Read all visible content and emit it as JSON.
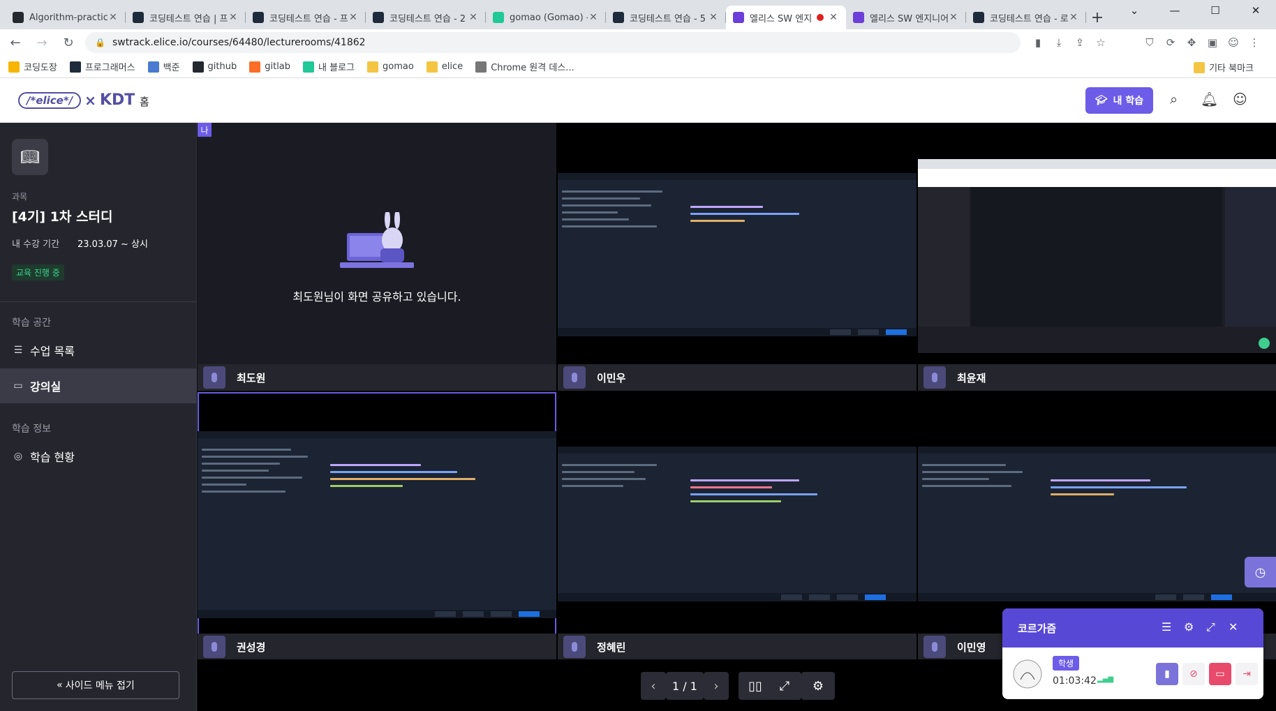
{
  "browser": {
    "tabs": [
      {
        "title": "Algorithm-practice/",
        "icon": "github-icon",
        "color": "#24292f"
      },
      {
        "title": "코딩테스트 연습 | 프",
        "icon": "programmers-icon",
        "color": "#1e2b3c"
      },
      {
        "title": "코딩테스트 연습 - 프",
        "icon": "programmers-icon",
        "color": "#1e2b3c"
      },
      {
        "title": "코딩테스트 연습 - 2",
        "icon": "programmers-icon",
        "color": "#1e2b3c"
      },
      {
        "title": "gomao (Gomao) - v",
        "icon": "velog-icon",
        "color": "#20c997"
      },
      {
        "title": "코딩테스트 연습 - 5",
        "icon": "programmers-icon",
        "color": "#1e2b3c"
      },
      {
        "title": "엘리스 SW 엔지",
        "icon": "elice-icon",
        "color": "#6c3fd9",
        "active": true
      },
      {
        "title": "엘리스 SW 엔지니어",
        "icon": "elice-icon",
        "color": "#6c3fd9"
      },
      {
        "title": "코딩테스트 연습 - 로",
        "icon": "programmers-icon",
        "color": "#1e2b3c"
      }
    ],
    "url": "swtrack.elice.io/courses/64480/lecturerooms/41862",
    "bookmarks": [
      {
        "label": "코딩도장",
        "color": "#f7b500"
      },
      {
        "label": "프로그래머스",
        "color": "#1e2b3c"
      },
      {
        "label": "백준",
        "color": "#4a7bd0"
      },
      {
        "label": "github",
        "color": "#24292f"
      },
      {
        "label": "gitlab",
        "color": "#fc6d26"
      },
      {
        "label": "내 블로그",
        "color": "#20c997"
      },
      {
        "label": "gomao",
        "color": "#f4c542"
      },
      {
        "label": "elice",
        "color": "#f4c542"
      },
      {
        "label": "Chrome 원격 데스...",
        "color": "#777"
      }
    ],
    "other_bookmarks": "기타 북마크"
  },
  "header": {
    "logo_text": "/*elice*/",
    "logo_kdt": "KDT",
    "home": "홈",
    "my_learning": "내 학습"
  },
  "sidebar": {
    "course_label": "과목",
    "course_title": "[4기] 1차 스터디",
    "period_label": "내 수강 기간",
    "period_value": "23.03.07 ~ 상시",
    "status": "교육 진행 중",
    "space_label": "학습 공간",
    "items": [
      {
        "label": "수업 목록"
      },
      {
        "label": "강의실"
      }
    ],
    "info_label": "학습 정보",
    "progress_label": "학습 현황",
    "fold_label": "사이드 메뉴 접기"
  },
  "grid": {
    "me_tag": "나",
    "sharing_message": "최도원님이 화면 공유하고 있습니다.",
    "participants": [
      "최도원",
      "이민우",
      "최윤재",
      "권성경",
      "정혜린",
      "이민영"
    ]
  },
  "controls": {
    "page": "1 / 1"
  },
  "panel": {
    "title": "코르가즘",
    "role": "학생",
    "elapsed": "01:03:42"
  },
  "colors": {
    "accent": "#6c5ce7",
    "sidebar_bg": "#25262d",
    "status_green": "#3ecf8e",
    "danger": "#e84a6b"
  }
}
